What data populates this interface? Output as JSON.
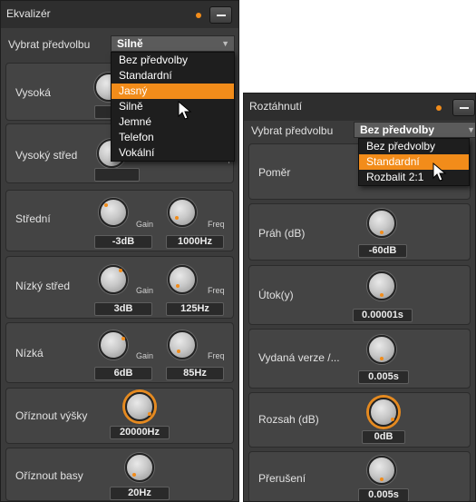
{
  "equalizer": {
    "title": "Ekvalizér",
    "preset_label": "Vybrat předvolbu",
    "preset_value": "Silně",
    "dropdown_options": [
      "Bez předvolby",
      "Standardní",
      "Jasný",
      "Silně",
      "Jemné",
      "Telefon",
      "Vokální"
    ],
    "highlighted_option": "Jasný",
    "gain_label": "Gain",
    "freq_label": "Freq",
    "rows": [
      {
        "label": "Vysoká",
        "gain": "",
        "freq": ""
      },
      {
        "label": "Vysoký střed",
        "gain": "",
        "freq": ""
      },
      {
        "label": "Střední",
        "gain": "-3dB",
        "freq": "1000Hz"
      },
      {
        "label": "Nízký střed",
        "gain": "3dB",
        "freq": "125Hz"
      },
      {
        "label": "Nízká",
        "gain": "6dB",
        "freq": "85Hz"
      }
    ],
    "high_cut": {
      "label": "Oříznout výšky",
      "value": "20000Hz"
    },
    "low_cut": {
      "label": "Oříznout basy",
      "value": "20Hz"
    }
  },
  "stretch": {
    "title": "Roztáhnutí",
    "preset_label": "Vybrat předvolbu",
    "preset_value": "Bez předvolby",
    "dropdown_options": [
      "Bez předvolby",
      "Standardní",
      "Rozbalit 2:1"
    ],
    "highlighted_option": "Standardní",
    "rows": [
      {
        "label": "Poměr",
        "value": ""
      },
      {
        "label": "Práh (dB)",
        "value": "-60dB"
      },
      {
        "label": "Útok(y)",
        "value": "0.00001s"
      },
      {
        "label": "Vydaná verze /...",
        "value": "0.005s"
      },
      {
        "label": "Rozsah (dB)",
        "value": "0dB"
      },
      {
        "label": "Přerušení",
        "value": "0.005s"
      }
    ]
  },
  "colors": {
    "accent": "#f28c1a",
    "panel": "#3b3b3b",
    "row": "#444444"
  }
}
